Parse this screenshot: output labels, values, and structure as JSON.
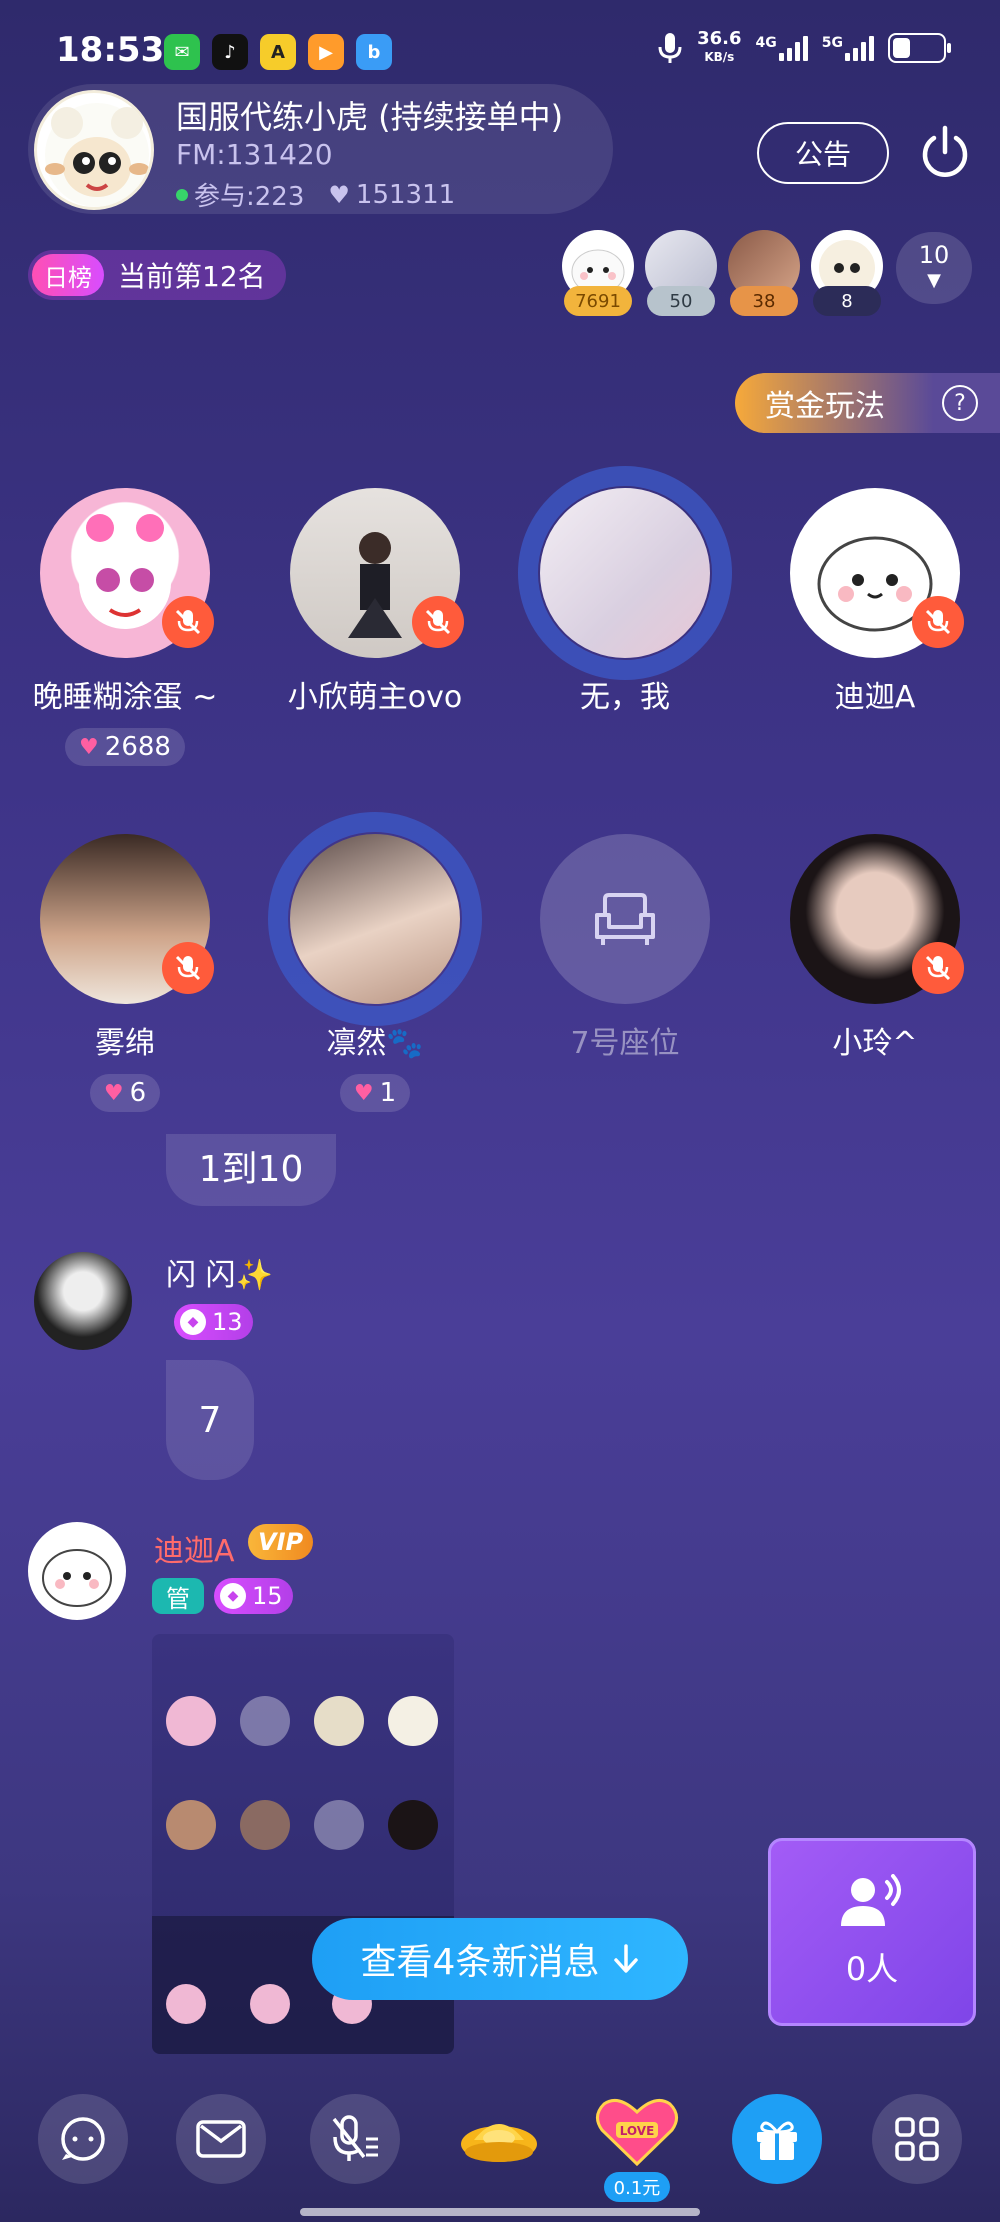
{
  "status_bar": {
    "time": "18:53",
    "net_speed": "36.6",
    "net_unit": "KB/s",
    "net1": "4G",
    "net2": "5G"
  },
  "room": {
    "title": "国服代练小虎 (持续接单中)",
    "fm": "FM:131420",
    "participants": "参与:223",
    "likes": "151311",
    "notice_label": "公告"
  },
  "rank": {
    "tag": "日榜",
    "text": "当前第12名"
  },
  "contributors": [
    {
      "score": "7691",
      "color": "#f2b43c"
    },
    {
      "score": "50",
      "color": "#9fb0c0"
    },
    {
      "score": "38",
      "color": "#e79448"
    },
    {
      "score": "8",
      "color": "#2c2c58"
    }
  ],
  "more_count": "10",
  "bounty_label": "赏金玩法",
  "seats": [
    {
      "name": "晚睡糊涂蛋 ~",
      "hearts": "2688",
      "muted": true
    },
    {
      "name": "小欣萌主ovo",
      "hearts": "",
      "muted": true
    },
    {
      "name": "无，我",
      "hearts": "",
      "muted": false,
      "speaking": true
    },
    {
      "name": "迪迦A",
      "hearts": "",
      "muted": true
    },
    {
      "name": "雾绵",
      "hearts": "6",
      "muted": true
    },
    {
      "name": "凛然🐾",
      "hearts": "1",
      "muted": false,
      "speaking": true
    },
    {
      "name": "7号座位",
      "hearts": "",
      "empty": true
    },
    {
      "name": "小玲^",
      "hearts": "",
      "muted": true
    }
  ],
  "chat": {
    "prev_bubble": "1到10",
    "messages": [
      {
        "name": "闪 闪✨",
        "level": "13",
        "text": "7"
      },
      {
        "name": "迪迦A",
        "vip": "VIP",
        "admin": "管",
        "level": "15",
        "image": true
      }
    ],
    "new_messages": "查看4条新消息"
  },
  "mic_queue_count": "0人",
  "gift_price": "0.1元",
  "colors": {
    "accent_blue": "#1e9ff5",
    "mute_red": "#ff5b3b",
    "level_purple": "#d84dff",
    "vip_gold": "#f9b63a",
    "admin_teal": "#1cb8b0"
  }
}
